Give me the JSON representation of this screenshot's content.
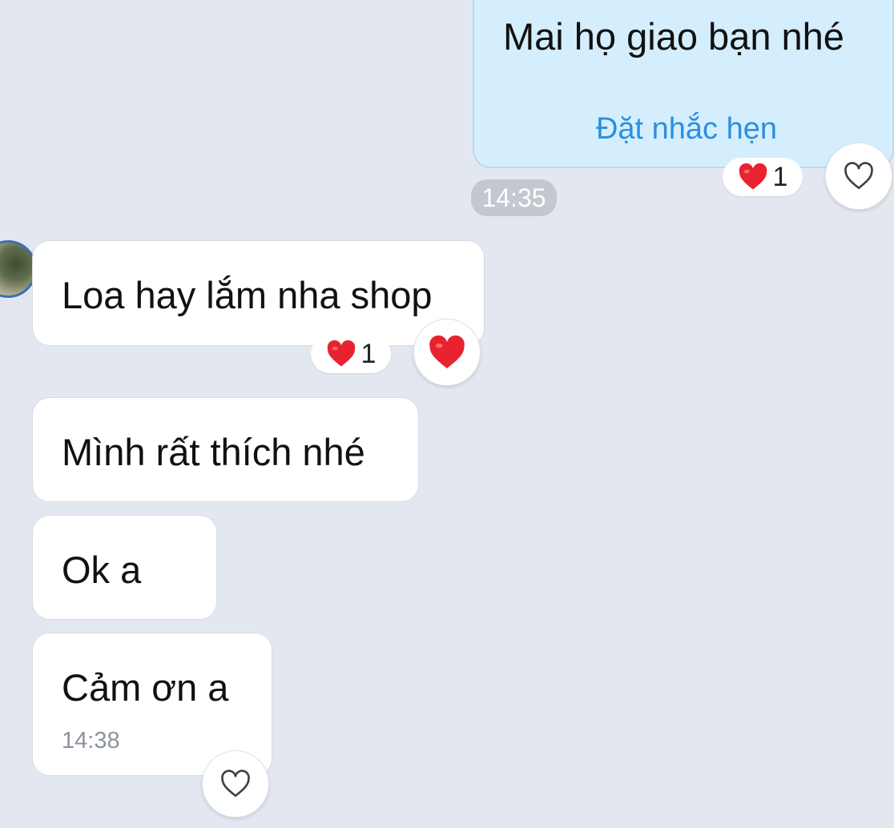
{
  "conversation": {
    "outgoing_message": {
      "text": "Mai họ giao bạn nhé",
      "action_label": "Đặt nhắc hẹn",
      "reaction_count": "1",
      "reaction_icon": "red-heart-icon",
      "react_button_icon": "heart-outline-icon"
    },
    "divider_time": "14:35",
    "incoming_messages": [
      {
        "text": "Loa hay lắm nha shop",
        "reaction_count": "1",
        "reaction_icon": "red-heart-icon",
        "react_button_icon": "red-heart-icon"
      },
      {
        "text": "Mình rất thích nhé"
      },
      {
        "text": "Ok a"
      },
      {
        "text": "Cảm ơn a",
        "time": "14:38",
        "react_button_icon": "heart-outline-icon"
      }
    ]
  },
  "colors": {
    "background": "#e3e8f0",
    "outgoing_bubble": "#d5eefd",
    "incoming_bubble": "#ffffff",
    "link_blue": "#2d8fe0",
    "heart_red": "#e8232f",
    "time_pill": "#c3c8d0"
  }
}
